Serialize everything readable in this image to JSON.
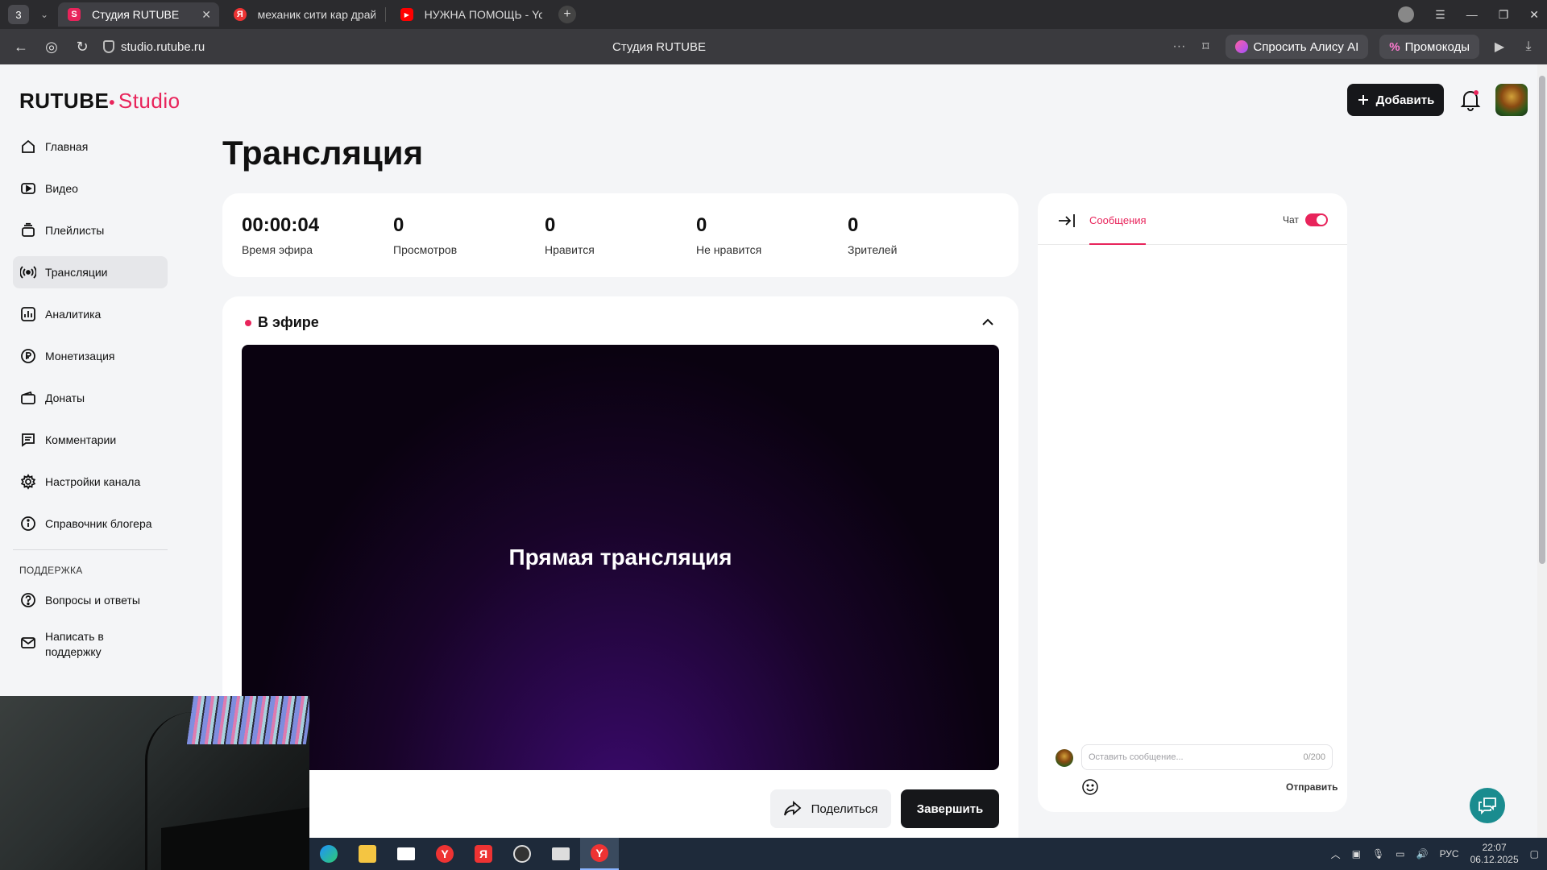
{
  "browser": {
    "tab_count": "3",
    "tabs": [
      {
        "label": "Студия RUTUBE",
        "icon_color": "#e8245b",
        "icon_text": "S"
      },
      {
        "label": "механик сити кар драйв",
        "icon_color": "#e33",
        "icon_text": "Я"
      },
      {
        "label": "НУЖНА ПОМОЩЬ - YouT",
        "icon_color": "#f00",
        "icon_text": "▶"
      }
    ],
    "url": "studio.rutube.ru",
    "page_title": "Студия RUTUBE",
    "alisa_label": "Спросить Алису AI",
    "promo_label": "Промокоды"
  },
  "app": {
    "logo_main": "RUTUBE",
    "logo_studio": "Studio",
    "add_button": "Добавить",
    "page_heading": "Трансляция"
  },
  "sidebar": {
    "items": [
      {
        "label": "Главная",
        "icon": "home-icon"
      },
      {
        "label": "Видео",
        "icon": "video-icon"
      },
      {
        "label": "Плейлисты",
        "icon": "playlist-icon"
      },
      {
        "label": "Трансляции",
        "icon": "broadcast-icon"
      },
      {
        "label": "Аналитика",
        "icon": "analytics-icon"
      },
      {
        "label": "Монетизация",
        "icon": "ruble-icon"
      },
      {
        "label": "Донаты",
        "icon": "wallet-icon"
      },
      {
        "label": "Комментарии",
        "icon": "comment-icon"
      },
      {
        "label": "Настройки канала",
        "icon": "gear-icon"
      },
      {
        "label": "Справочник блогера",
        "icon": "info-icon"
      }
    ],
    "support_section": "ПОДДЕРЖКА",
    "support_items": [
      {
        "label": "Вопросы и ответы",
        "icon": "question-icon"
      },
      {
        "label": "Написать в поддержку",
        "icon": "mail-icon"
      }
    ]
  },
  "stats": [
    {
      "value": "00:00:04",
      "label": "Время эфира"
    },
    {
      "value": "0",
      "label": "Просмотров"
    },
    {
      "value": "0",
      "label": "Нравится"
    },
    {
      "value": "0",
      "label": "Не нравится"
    },
    {
      "value": "0",
      "label": "Зрителей"
    }
  ],
  "live": {
    "status_label": "В эфире",
    "video_text": "Прямая трансляция",
    "share_button": "Поделиться",
    "end_button": "Завершить"
  },
  "chat": {
    "tab_label": "Сообщения",
    "toggle_label": "Чат",
    "input_placeholder": "Оставить сообщение...",
    "counter": "0/200",
    "send_label": "Отправить"
  },
  "taskbar": {
    "lang": "РУС",
    "time": "22:07",
    "date": "06.12.2025"
  },
  "colors": {
    "accent": "#e8245b",
    "dark_button": "#16171a",
    "help_fab": "#1a8c8f"
  }
}
